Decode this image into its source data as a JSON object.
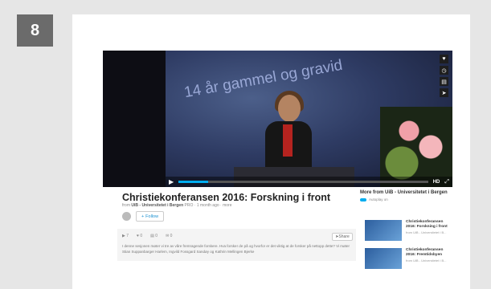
{
  "step_number": "8",
  "video": {
    "slide_text": "14 år gammel og gravid",
    "hd_label": "HD",
    "title": "Christiekonferansen 2016: Forskning i front",
    "byline_from": "from",
    "author": "UiB - Universitetet i Bergen",
    "author_badge": "PRO",
    "time_ago": "1 month ago",
    "more_link": "more",
    "progress_fraction": 0.12,
    "follow_label": "Follow"
  },
  "stats": {
    "plays": "7",
    "likes": "0",
    "collections": "0",
    "comments": "0",
    "share_label": "Share"
  },
  "description": "I denne sesjonen møter vi tre av våre fremragende forskere. Hva forsker de på og hvorfor er det viktig at de forsker på nettopp dette? Vi møter Stian Suppanbarger Harlem, Ingvild Fossgard Sandøy og Kathrin Mellingen Bjerke",
  "sidebar": {
    "more_from": "More from UiB - Universitetet i Bergen",
    "autoplay": "Autoplay on",
    "items": [
      {
        "title": "Christiekonferansen 2016: Forskning i front",
        "source": "from UiB - Universitetet i B..."
      },
      {
        "title": "Christiekonferansen 2016: Fremtidsbyen",
        "source": "from UiB - Universitetet i B..."
      }
    ]
  },
  "icons": [
    "heart-icon",
    "clock-icon",
    "layers-icon",
    "share-icon",
    "play-icon",
    "fullscreen-icon"
  ]
}
